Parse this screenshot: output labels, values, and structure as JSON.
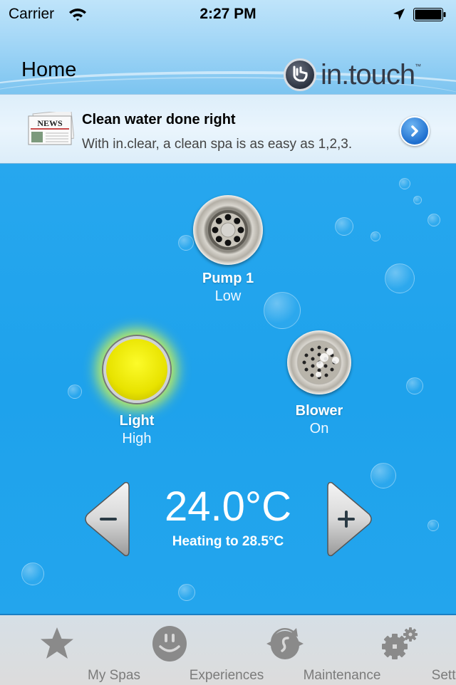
{
  "status_bar": {
    "carrier": "Carrier",
    "time": "2:27 PM",
    "icons": [
      "wifi-icon",
      "location-arrow-icon",
      "battery-icon"
    ]
  },
  "header": {
    "title": "Home",
    "logo_text": "in.touch",
    "logo_trademark": "™"
  },
  "news": {
    "icon": "newspaper-icon",
    "icon_label": "NEWS",
    "headline": "Clean water done right",
    "subtitle": "With in.clear, a clean spa is as easy as 1,2,3.",
    "action_icon": "chevron-right-circle-icon"
  },
  "controls": [
    {
      "id": "pump1",
      "label": "Pump 1",
      "state": "Low",
      "icon": "pump-jet-icon"
    },
    {
      "id": "light",
      "label": "Light",
      "state": "High",
      "icon": "light-bulb-icon",
      "color": "#f2ee00"
    },
    {
      "id": "blower",
      "label": "Blower",
      "state": "On",
      "icon": "blower-jet-icon"
    }
  ],
  "temperature": {
    "current": "24.0°C",
    "status": "Heating to 28.5°C",
    "decrease_icon": "minus-icon",
    "increase_icon": "plus-icon"
  },
  "tabbar": {
    "items": [
      {
        "label": "My Spas",
        "icon": "star-icon"
      },
      {
        "label": "Experiences",
        "icon": "smiley-icon"
      },
      {
        "label": "Maintenance",
        "icon": "maintenance-icon"
      },
      {
        "label": "Settings",
        "icon": "gears-icon"
      }
    ]
  },
  "colors": {
    "water": "#1ea2ec",
    "header": "#a6d8f7",
    "tabbar": "#dcdcdc",
    "tab_icon": "#8a8a8a"
  }
}
